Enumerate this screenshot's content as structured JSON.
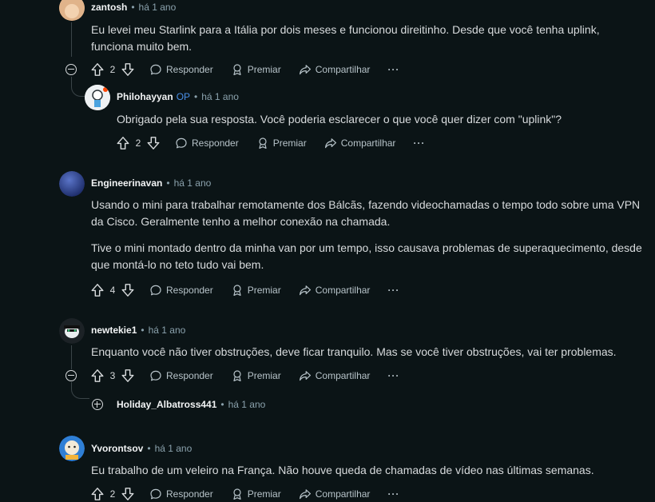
{
  "comments": [
    {
      "author": "zantosh",
      "time": "há 1 ano",
      "body": [
        "Eu levei meu Starlink para a Itália por dois meses e funcionou direitinho. Desde que você tenha uplink, funciona muito bem."
      ],
      "votes": "2"
    },
    {
      "author": "Philohayyan",
      "op_badge": "OP",
      "time": "há 1 ano",
      "body": [
        "Obrigado pela sua resposta. Você poderia esclarecer o que você quer dizer com \"uplink\"?"
      ],
      "votes": "2"
    },
    {
      "author": "Engineerinavan",
      "time": "há 1 ano",
      "body": [
        "Usando o mini para trabalhar remotamente dos Bálcãs, fazendo videochamadas o tempo todo sobre uma VPN da Cisco. Geralmente tenho a melhor conexão na chamada.",
        "Tive o mini montado dentro da minha van por um tempo, isso causava problemas de superaquecimento, desde que montá-lo no teto tudo vai bem."
      ],
      "votes": "4"
    },
    {
      "author": "newtekie1",
      "time": "há 1 ano",
      "body": [
        "Enquanto você não tiver obstruções, deve ficar tranquilo. Mas se você tiver obstruções, vai ter problemas."
      ],
      "votes": "3"
    },
    {
      "author": "Holiday_Albatross441",
      "time": "há 1 ano"
    },
    {
      "author": "Yvorontsov",
      "time": "há 1 ano",
      "body": [
        "Eu trabalho de um veleiro na França. Não houve queda de chamadas de vídeo nas últimas semanas."
      ],
      "votes": "2"
    }
  ],
  "actions": {
    "reply": "Responder",
    "award": "Premiar",
    "share": "Compartilhar",
    "more": "···"
  },
  "icons": [
    "upvote-icon",
    "downvote-icon",
    "comment-bubble-icon",
    "award-icon",
    "share-arrow-icon",
    "collapse-icon",
    "expand-icon"
  ],
  "colors": {
    "background": "#0b1416",
    "op_badge": "#4a8fe7",
    "meta": "#8ba2ad"
  }
}
